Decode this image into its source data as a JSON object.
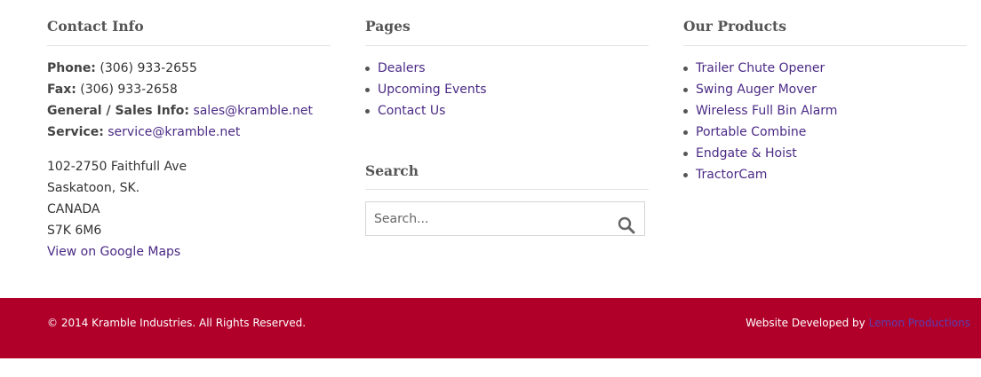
{
  "contact": {
    "heading": "Contact Info",
    "phone_label": "Phone:",
    "phone": "(306) 933-2655",
    "fax_label": "Fax:",
    "fax": "(306) 933-2658",
    "sales_label": "General / Sales Info:",
    "sales_email": "sales@kramble.net",
    "service_label": "Service:",
    "service_email": "service@kramble.net",
    "address": [
      "102-2750 Faithfull Ave",
      "Saskatoon, SK.",
      "CANADA",
      "S7K 6M6"
    ],
    "map_link": "View on Google Maps"
  },
  "pages": {
    "heading": "Pages",
    "items": [
      "Dealers",
      "Upcoming Events",
      "Contact Us"
    ]
  },
  "search": {
    "heading": "Search",
    "placeholder": "Search...",
    "icon": "search-icon"
  },
  "products": {
    "heading": "Our Products",
    "items": [
      "Trailer Chute Opener",
      "Swing Auger Mover",
      "Wireless Full Bin Alarm",
      "Portable Combine",
      "Endgate & Hoist",
      "TractorCam"
    ]
  },
  "footer": {
    "copyright": "© 2014 Kramble Industries. All Rights Reserved.",
    "credit_prefix": "Website Developed by",
    "credit_link": "Lemon Productions"
  },
  "colors": {
    "footer_bg": "#b0002a",
    "link": "#4a2a85",
    "dev_link": "#5a3fb0"
  }
}
